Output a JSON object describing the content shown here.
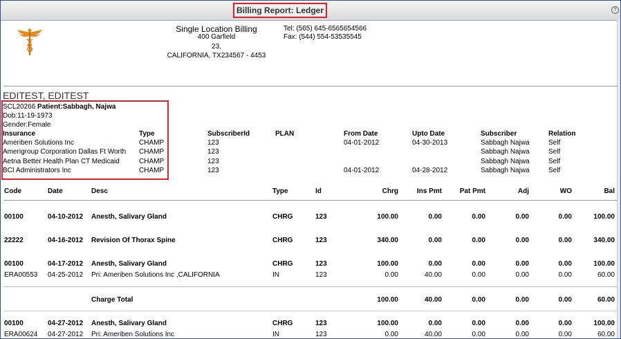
{
  "window": {
    "title": "Billing Report: Ledger"
  },
  "practice": {
    "name": "Single Location Billing",
    "address1": "400 Garfield",
    "address2": "23,",
    "address3": "CALIFORNIA, TX234567 - 4453",
    "tel": "Tel: (565) 645-6565654566",
    "fax": "Fax: (544) 554-53535545"
  },
  "patient": {
    "heading": "EDITEST, EDITEST",
    "account": "SCL20266",
    "patient_label": "Patient:",
    "patient_name": "Sabbagh, Najwa",
    "dob": "Dob:11-19-1973",
    "gender": "Gender:Female"
  },
  "insurance_headers": [
    "Insurance",
    "Type",
    "SubscriberId",
    "PLAN",
    "From Date",
    "Upto Date",
    "Subscriber",
    "Relation"
  ],
  "insurances": [
    {
      "name": "Ameriben Solutions Inc",
      "type": "CHAMP",
      "subscriber_id": "123",
      "plan": "",
      "from": "04-01-2012",
      "upto": "04-30-2013",
      "subscriber": "Sabbagh Najwa",
      "relation": "Self"
    },
    {
      "name": "Amerigroup Corporation Dallas Ft Worth",
      "type": "CHAMP",
      "subscriber_id": "123",
      "plan": "",
      "from": "",
      "upto": "",
      "subscriber": "Sabbagh Najwa",
      "relation": "Self"
    },
    {
      "name": "Aetna Better Health Plan CT Medicaid",
      "type": "CHAMP",
      "subscriber_id": "123",
      "plan": "",
      "from": "",
      "upto": "",
      "subscriber": "Sabbagh Najwa",
      "relation": "Self"
    },
    {
      "name": "BCI Administrators Inc",
      "type": "CHAMP",
      "subscriber_id": "123",
      "plan": "",
      "from": "04-01-2012",
      "upto": "04-28-2012",
      "subscriber": "Sabbagh Najwa",
      "relation": "Self"
    }
  ],
  "ledger_headers": [
    "Code",
    "Date",
    "Desc",
    "Type",
    "Id",
    "Chrg",
    "Ins Pmt",
    "Pat Pmt",
    "Adj",
    "WO",
    "Bal"
  ],
  "ledger_rows": [
    {
      "code": "00100",
      "date": "04-10-2012",
      "desc": "Anesth, Salivary Gland",
      "type": "CHRG",
      "id": "123",
      "chrg": "100.00",
      "ins": "0.00",
      "pat": "0.00",
      "adj": "0.00",
      "wo": "0.00",
      "bal": "100.00"
    },
    {
      "code": "22222",
      "date": "04-16-2012",
      "desc": "Revision Of Thorax Spine",
      "type": "CHRG",
      "id": "123",
      "chrg": "340.00",
      "ins": "0.00",
      "pat": "0.00",
      "adj": "0.00",
      "wo": "0.00",
      "bal": "340.00"
    },
    {
      "code": "00100",
      "date": "04-17-2012",
      "desc": "Anesth, Salivary Gland",
      "type": "CHRG",
      "id": "123",
      "chrg": "100.00",
      "ins": "0.00",
      "pat": "0.00",
      "adj": "0.00",
      "wo": "0.00",
      "bal": "100.00"
    },
    {
      "code": "ERA00553",
      "date": "04-25-2012",
      "desc": "Pri: Ameriben Solutions Inc ,CALIFORNIA",
      "type": "IN",
      "id": "123",
      "chrg": "0.00",
      "ins": "40.00",
      "pat": "0.00",
      "adj": "0.00",
      "wo": "0.00",
      "bal": "60.00"
    },
    {
      "code": "00100",
      "date": "04-27-2012",
      "desc": "Anesth, Salivary Gland",
      "type": "CHRG",
      "id": "123",
      "chrg": "100.00",
      "ins": "0.00",
      "pat": "0.00",
      "adj": "0.00",
      "wo": "0.00",
      "bal": "100.00"
    },
    {
      "code": "ERA00624",
      "date": "04-27-2012",
      "desc": "Pri: Ameriben Solutions Inc",
      "type": "IN",
      "id": "123",
      "chrg": "0.00",
      "ins": "40.00",
      "pat": "0.00",
      "adj": "0.00",
      "wo": "0.00",
      "bal": "60.00"
    }
  ],
  "charge_total": {
    "label": "Charge Total",
    "chrg": "100.00",
    "ins": "40.00",
    "pat": "0.00",
    "adj": "0.00",
    "wo": "0.00",
    "bal": "60.00"
  },
  "icons": {
    "logo": "caduceus-icon",
    "corner": "help-icon"
  },
  "colors": {
    "highlight": "#e0202a",
    "frame": "#2b4fa3",
    "logo": "#e8891c"
  }
}
